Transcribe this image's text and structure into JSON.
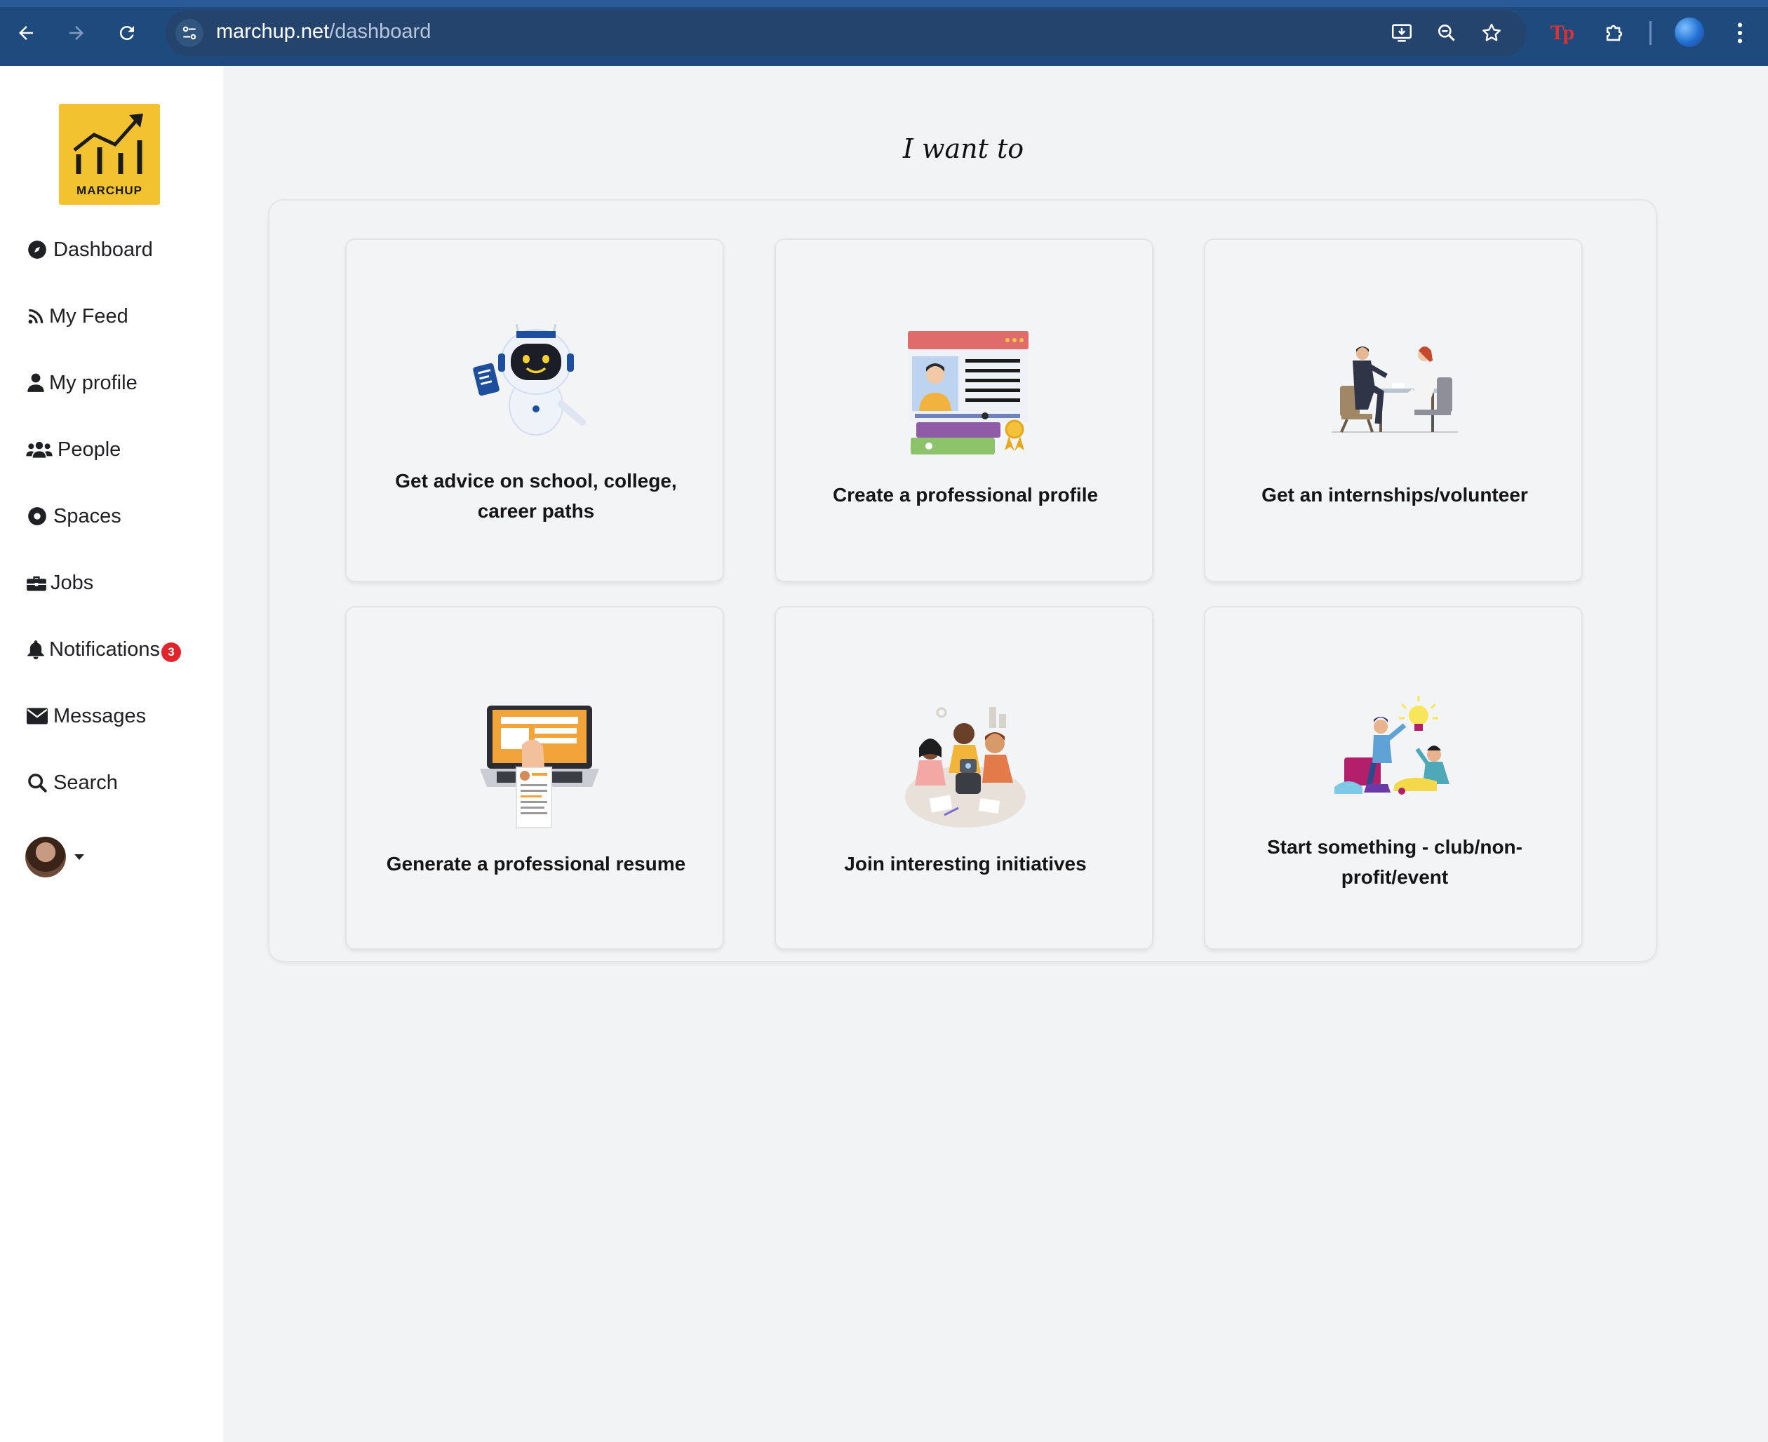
{
  "browser": {
    "url_host": "marchup.net",
    "url_path": "/dashboard",
    "extension_logo": "Tp"
  },
  "sidebar": {
    "logo_text": "MARCHUP",
    "items": [
      {
        "label": "Dashboard",
        "icon": "compass-icon"
      },
      {
        "label": "My Feed",
        "icon": "rss-icon"
      },
      {
        "label": "My profile",
        "icon": "user-icon"
      },
      {
        "label": "People",
        "icon": "users-icon"
      },
      {
        "label": "Spaces",
        "icon": "circle-dot-icon"
      },
      {
        "label": "Jobs",
        "icon": "briefcase-icon"
      },
      {
        "label": "Notifications",
        "icon": "bell-icon",
        "badge": "3"
      },
      {
        "label": "Messages",
        "icon": "envelope-icon"
      },
      {
        "label": "Search",
        "icon": "search-icon"
      }
    ]
  },
  "main": {
    "heading": "I want to",
    "cards": [
      {
        "label": "Get advice on school, college, career paths",
        "icon": "robot-assistant-icon"
      },
      {
        "label": "Create a professional profile",
        "icon": "profile-page-icon"
      },
      {
        "label": "Get an internships/volunteer",
        "icon": "interview-meeting-icon"
      },
      {
        "label": "Generate a professional resume",
        "icon": "laptop-resume-icon"
      },
      {
        "label": "Join interesting initiatives",
        "icon": "team-collaboration-icon"
      },
      {
        "label": "Start something - club/non-profit/event",
        "icon": "idea-lightbulb-icon"
      }
    ]
  },
  "colors": {
    "chrome": "#1e4a7e",
    "logo_bg": "#f2c230",
    "badge": "#e0242c",
    "page_bg": "#f2f3f5"
  }
}
